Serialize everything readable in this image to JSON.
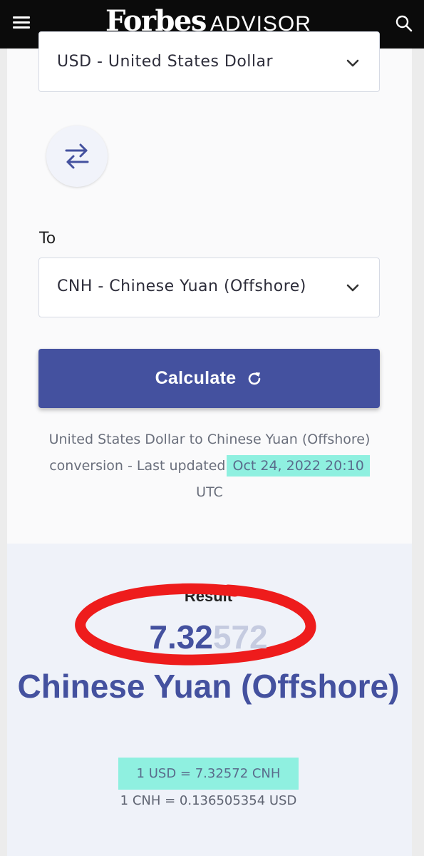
{
  "header": {
    "logo_primary": "Forbes",
    "logo_secondary": "ADVISOR",
    "menu_icon": "hamburger-menu-icon",
    "search_icon": "search-icon"
  },
  "converter": {
    "from_currency": "USD - United States Dollar",
    "to_label": "To",
    "to_currency": "CNH - Chinese Yuan (Offshore)",
    "swap_icon": "swap-arrows-icon",
    "calculate_label": "Calculate",
    "calculate_icon": "refresh-icon",
    "update_prefix": "United States Dollar to Chinese Yuan (Offshore) conversion - Last updated",
    "update_date": "Oct 24, 2022 20:10",
    "update_suffix": "UTC"
  },
  "result": {
    "label": "Result",
    "value_main": "7.32",
    "value_fade": "572",
    "currency_name": "Chinese Yuan (Offshore)",
    "rate_forward": "1 USD = 7.32572 CNH",
    "rate_reverse": "1 CNH = 0.136505354 USD"
  },
  "colors": {
    "header_bg": "#0b0b0b",
    "accent": "#44519f",
    "highlight": "#8ff0e0",
    "annotation_red": "#ee1c1c"
  }
}
